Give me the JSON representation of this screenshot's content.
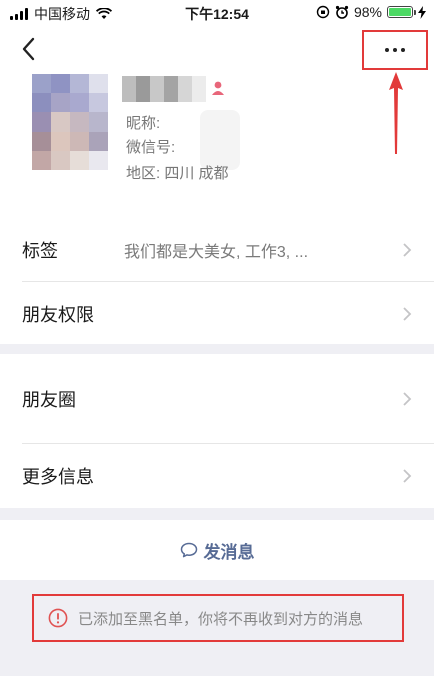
{
  "status_bar": {
    "carrier": "中国移动",
    "time": "下午12:54",
    "battery": "98%",
    "battery_level": 0.98
  },
  "header": {
    "back_icon": "chevron-left-icon",
    "more_icon": "more-dots-icon"
  },
  "profile": {
    "nickname_label": "昵称:",
    "wechat_id_label": "微信号:",
    "region": "地区:  四川 成都",
    "gender_icon": "female-icon",
    "gender_color": "#e8667a"
  },
  "rows": {
    "tags_label": "标签",
    "tags_value": "我们都是大美女, 工作3, ...",
    "permissions_label": "朋友权限",
    "moments_label": "朋友圈",
    "more_info_label": "更多信息"
  },
  "actions": {
    "send_message": "发消息",
    "send_icon": "chat-bubble-icon"
  },
  "notice": {
    "text": "已添加至黑名单，你将不再收到对方的消息",
    "icon": "warning-circle-icon"
  },
  "colors": {
    "accent_link": "#576b95",
    "annotation_red": "#e23a3a",
    "background": "#efeff4"
  }
}
